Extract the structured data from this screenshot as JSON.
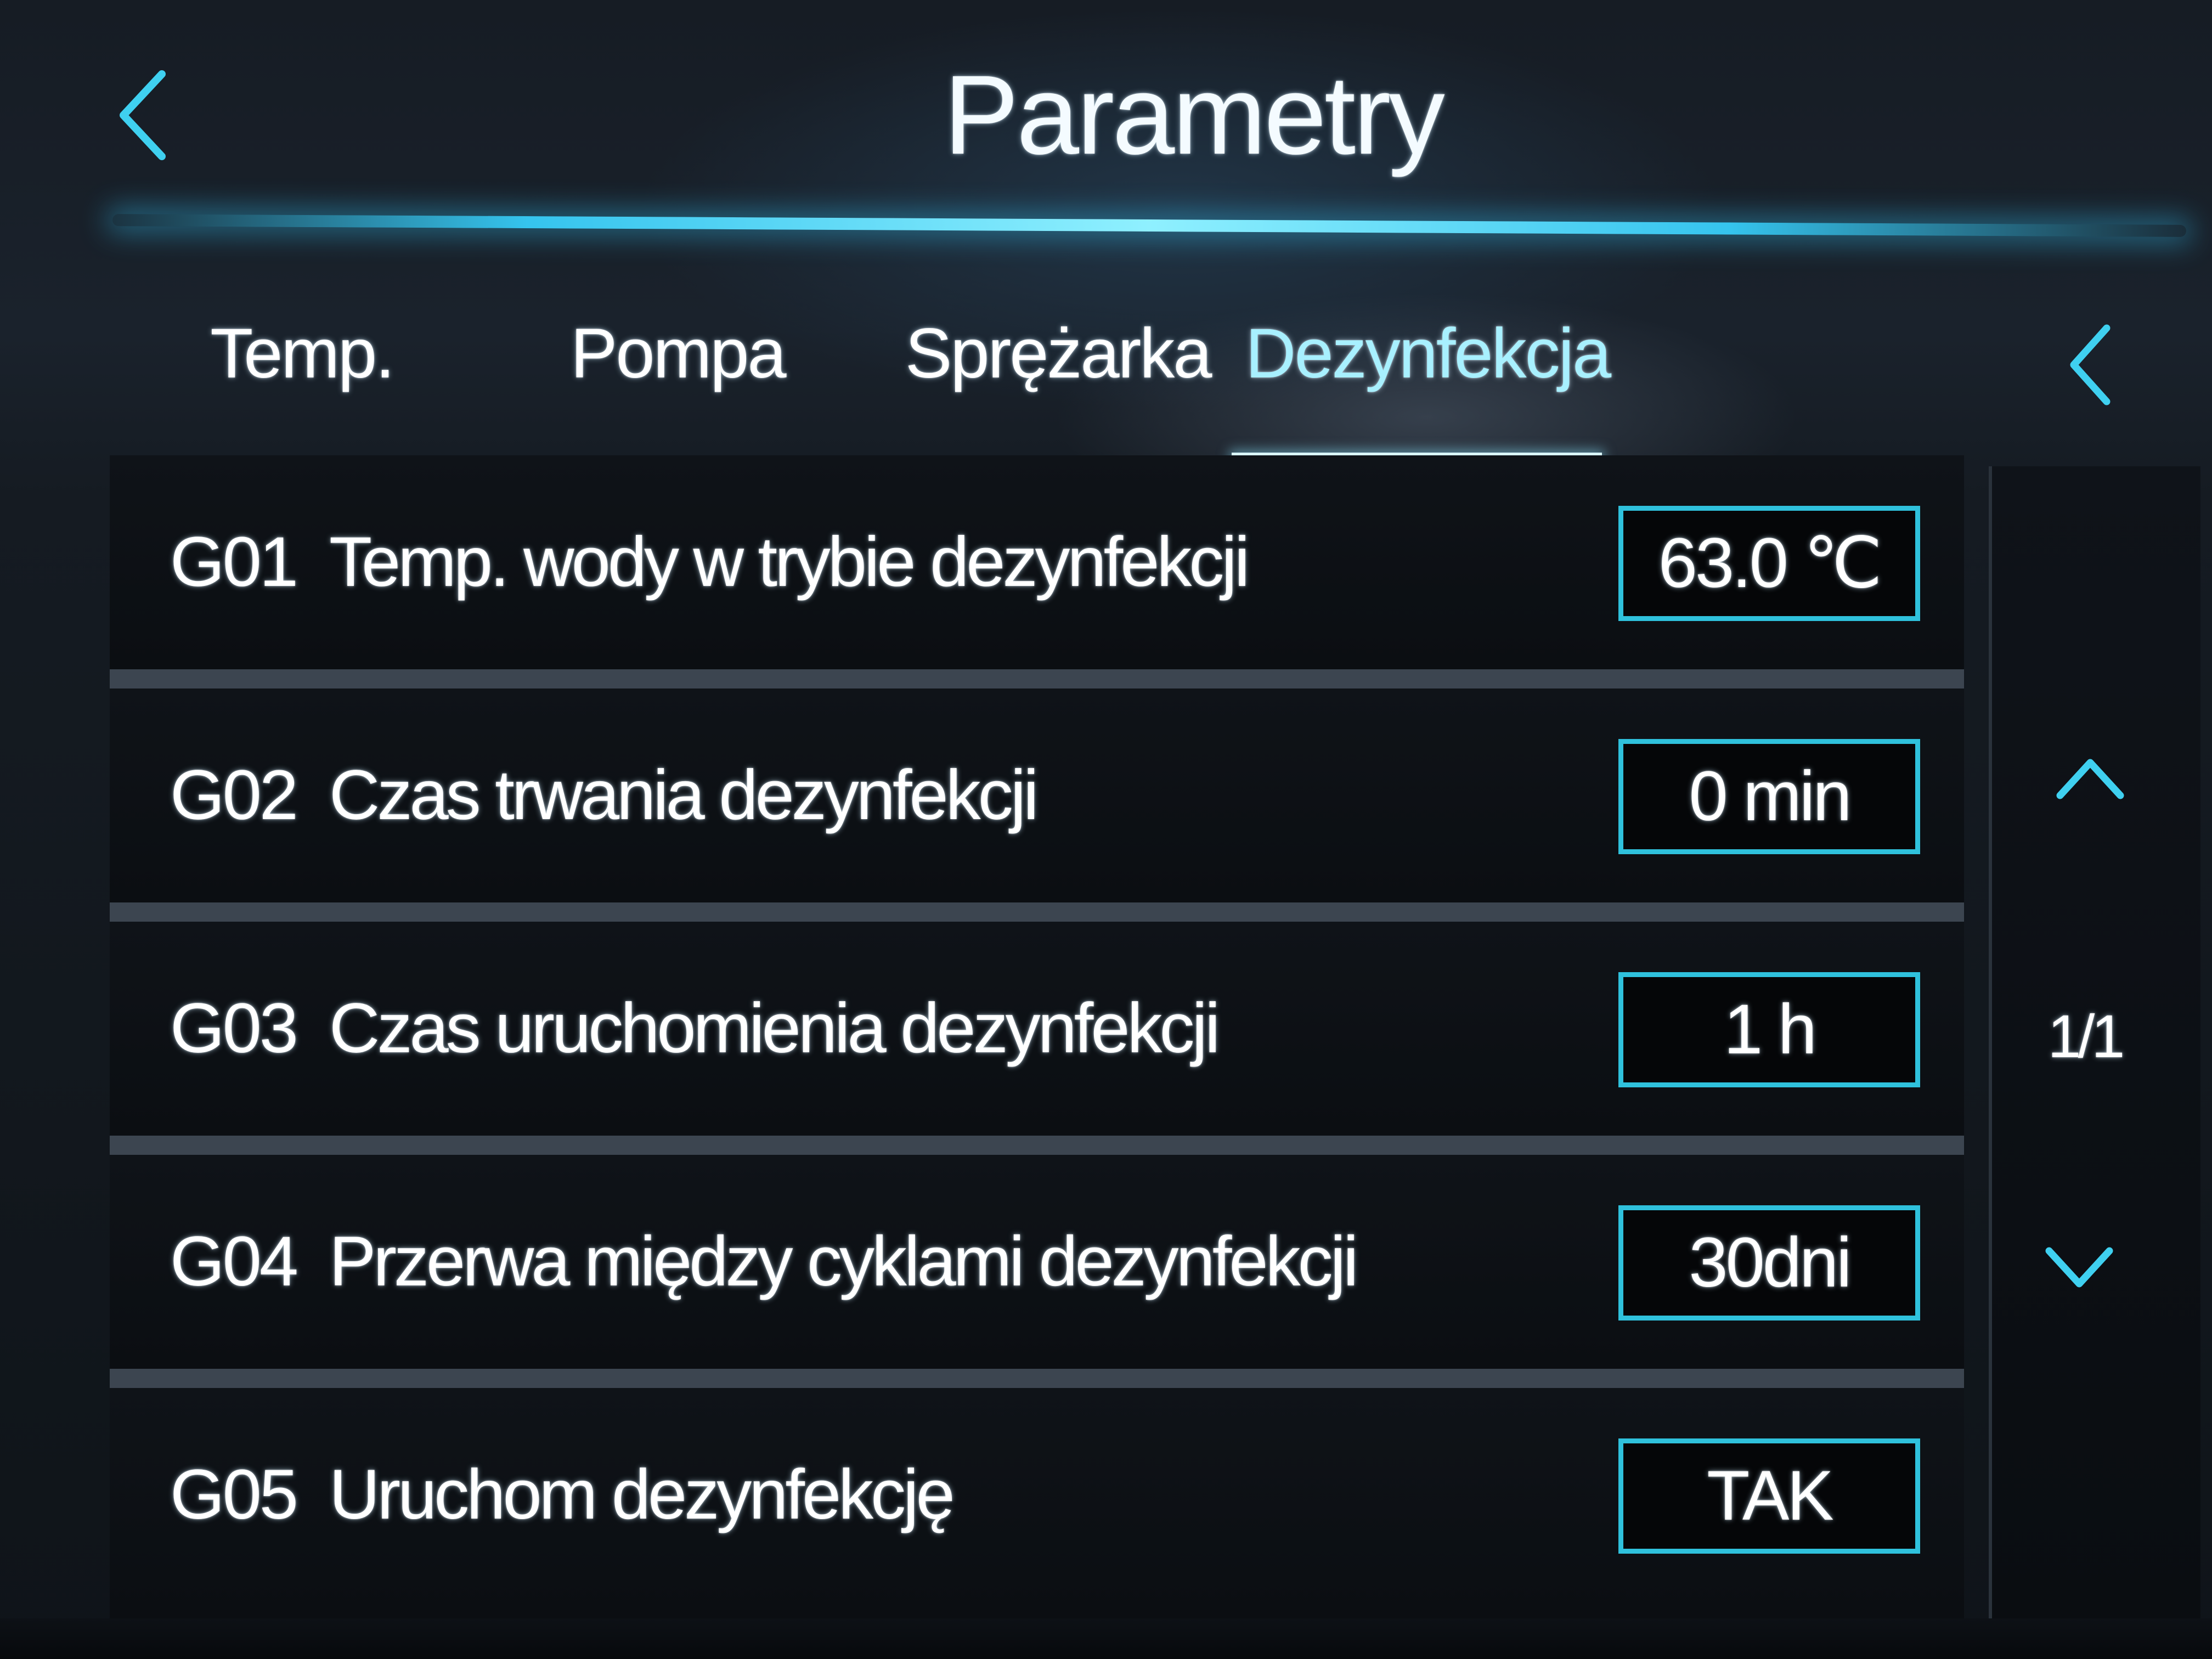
{
  "header": {
    "title": "Parametry",
    "back_icon": "chevron-left-icon"
  },
  "tabs": [
    {
      "label": "Temp.",
      "active": false
    },
    {
      "label": "Pompa",
      "active": false
    },
    {
      "label": "Sprężarka",
      "active": false
    },
    {
      "label": "Dezynfekcja",
      "active": true
    }
  ],
  "tabs_scroll_icon": "chevron-left-icon",
  "parameters": [
    {
      "code": "G01",
      "label": "Temp. wody w trybie dezynfekcji",
      "value": "63.0 ℃"
    },
    {
      "code": "G02",
      "label": "Czas trwania dezynfekcji",
      "value": "0 min"
    },
    {
      "code": "G03",
      "label": "Czas uruchomienia dezynfekcji",
      "value": "1 h"
    },
    {
      "code": "G04",
      "label": "Przerwa między cyklami dezynfekcji",
      "value": "30dni"
    },
    {
      "code": "G05",
      "label": "Uruchom dezynfekcję",
      "value": "TAK"
    }
  ],
  "pager": {
    "indicator": "1/1",
    "up_icon": "chevron-up-icon",
    "down_icon": "chevron-down-icon"
  },
  "colors": {
    "accent": "#2fc1dc",
    "active_tab": "#a8f0ff",
    "background": "#0b0f14"
  }
}
